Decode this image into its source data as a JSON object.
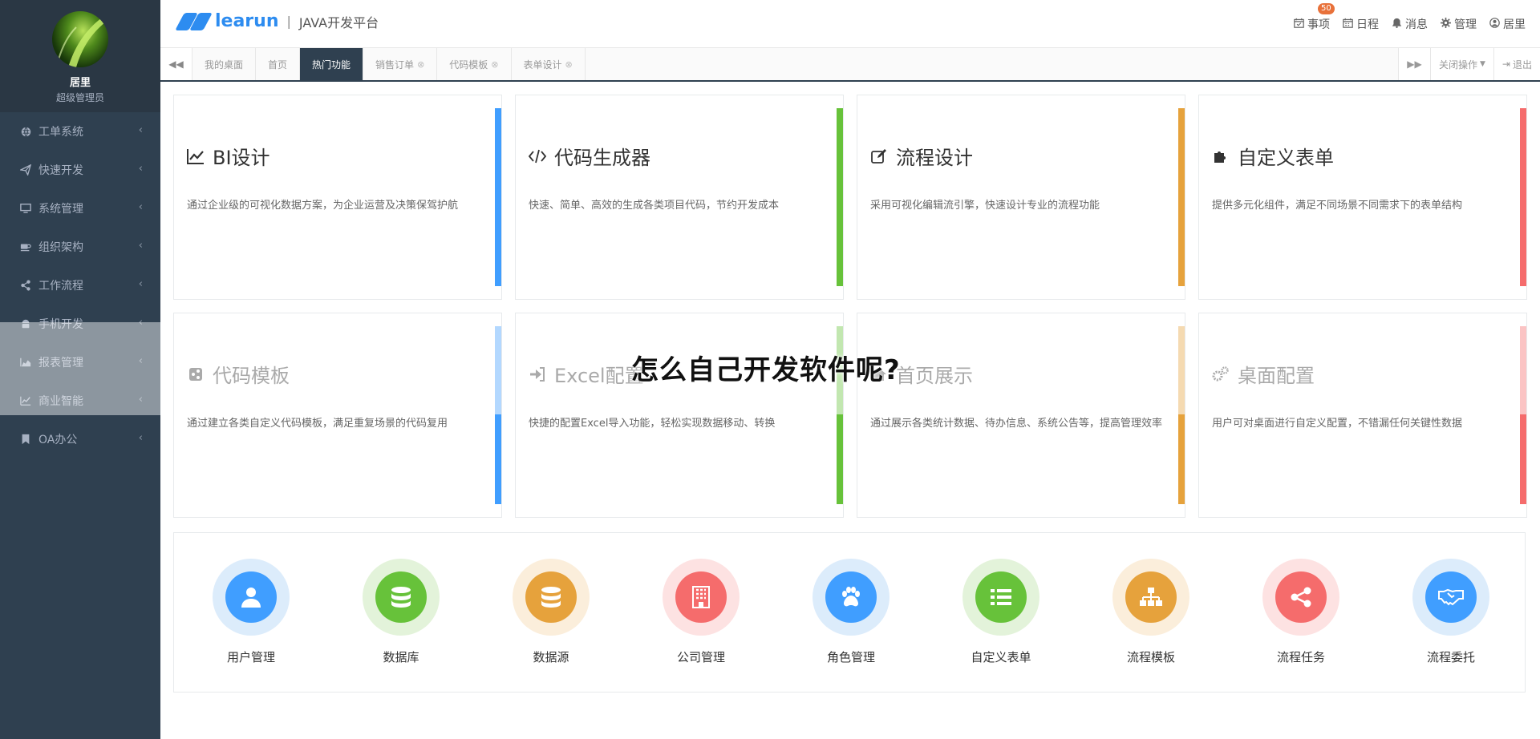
{
  "profile": {
    "name": "居里",
    "role": "超级管理员"
  },
  "sidebar": {
    "items": [
      {
        "label": "工单系统",
        "icon": "globe-icon"
      },
      {
        "label": "快速开发",
        "icon": "send-icon"
      },
      {
        "label": "系统管理",
        "icon": "monitor-icon"
      },
      {
        "label": "组织架构",
        "icon": "coffee-icon"
      },
      {
        "label": "工作流程",
        "icon": "share-icon"
      },
      {
        "label": "手机开发",
        "icon": "android-icon"
      },
      {
        "label": "报表管理",
        "icon": "area-chart-icon"
      },
      {
        "label": "商业智能",
        "icon": "line-chart-icon"
      },
      {
        "label": "OA办公",
        "icon": "bookmark-icon"
      }
    ],
    "chevron": "‹"
  },
  "header": {
    "logo_text": "learun",
    "separator": "|",
    "subtitle": "JAVA开发平台",
    "nav": [
      {
        "label": "事项",
        "icon": "calendar-check-icon",
        "badge": "50"
      },
      {
        "label": "日程",
        "icon": "calendar-icon"
      },
      {
        "label": "消息",
        "icon": "bell-icon"
      },
      {
        "label": "管理",
        "icon": "gear-icon"
      },
      {
        "label": "居里",
        "icon": "user-circle-icon"
      }
    ]
  },
  "tabbar": {
    "tabs": [
      {
        "label": "我的桌面",
        "closable": false
      },
      {
        "label": "首页",
        "closable": false
      },
      {
        "label": "热门功能",
        "closable": false,
        "active": true
      },
      {
        "label": "销售订单",
        "closable": true
      },
      {
        "label": "代码模板",
        "closable": true
      },
      {
        "label": "表单设计",
        "closable": true
      }
    ],
    "close_ops": "关闭操作",
    "logout": "退出"
  },
  "cards": [
    {
      "title": "BI设计",
      "desc": "通过企业级的可视化数据方案，为企业运营及决策保驾护航",
      "icon": "line-chart-icon",
      "color": "#409eff"
    },
    {
      "title": "代码生成器",
      "desc": "快速、简单、高效的生成各类项目代码，节约开发成本",
      "icon": "code-icon",
      "color": "#67c23a"
    },
    {
      "title": "流程设计",
      "desc": "采用可视化编辑流引擎，快速设计专业的流程功能",
      "icon": "edit-icon",
      "color": "#e6a23c"
    },
    {
      "title": "自定义表单",
      "desc": "提供多元化组件，满足不同场景不同需求下的表单结构",
      "icon": "puzzle-icon",
      "color": "#f56c6c"
    },
    {
      "title": "代码模板",
      "desc": "通过建立各类自定义代码模板，满足重复场景的代码复用",
      "icon": "share-square-icon",
      "color": "#409eff"
    },
    {
      "title": "Excel配置",
      "desc": "快捷的配置Excel导入功能，轻松实现数据移动、转换",
      "icon": "sign-in-icon",
      "color": "#67c23a"
    },
    {
      "title": "首页展示",
      "desc": "通过展示各类统计数据、待办信息、系统公告等，提高管理效率",
      "icon": "home-icon",
      "color": "#e6a23c"
    },
    {
      "title": "桌面配置",
      "desc": "用户可对桌面进行自定义配置，不错漏任何关键性数据",
      "icon": "gears-icon",
      "color": "#f56c6c"
    }
  ],
  "quick_icons": [
    {
      "label": "用户管理",
      "icon": "user-icon",
      "color": "#409eff",
      "ring": "#dcecfb"
    },
    {
      "label": "数据库",
      "icon": "database-icon",
      "color": "#67c23a",
      "ring": "#e3f3da"
    },
    {
      "label": "数据源",
      "icon": "database-icon",
      "color": "#e6a23c",
      "ring": "#fbeedb"
    },
    {
      "label": "公司管理",
      "icon": "building-icon",
      "color": "#f56c6c",
      "ring": "#fde2e2"
    },
    {
      "label": "角色管理",
      "icon": "paw-icon",
      "color": "#409eff",
      "ring": "#dcecfb"
    },
    {
      "label": "自定义表单",
      "icon": "list-icon",
      "color": "#67c23a",
      "ring": "#e3f3da"
    },
    {
      "label": "流程模板",
      "icon": "sitemap-icon",
      "color": "#e6a23c",
      "ring": "#fbeedb"
    },
    {
      "label": "流程任务",
      "icon": "share-alt-icon",
      "color": "#f56c6c",
      "ring": "#fde2e2"
    },
    {
      "label": "流程委托",
      "icon": "handshake-icon",
      "color": "#409eff",
      "ring": "#dcecfb"
    }
  ],
  "overlay_title": "怎么自己开发软件呢?"
}
